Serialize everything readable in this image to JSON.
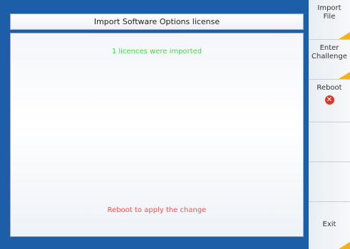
{
  "dialog": {
    "title": "Import Software Options license",
    "message_imported": "1 licences were imported",
    "message_reboot": "Reboot to apply the change"
  },
  "softkeys": {
    "import_file": "Import\nFile",
    "enter_challenge": "Enter\nChallenge",
    "reboot": "Reboot",
    "exit": "Exit"
  },
  "colors": {
    "frame": "#1c5ea8",
    "success_text": "#3fdc3f",
    "warning_text": "#ff4a4a",
    "tab_accent": "#f2b21a"
  },
  "icons": {
    "reboot": "close-circle-icon"
  }
}
